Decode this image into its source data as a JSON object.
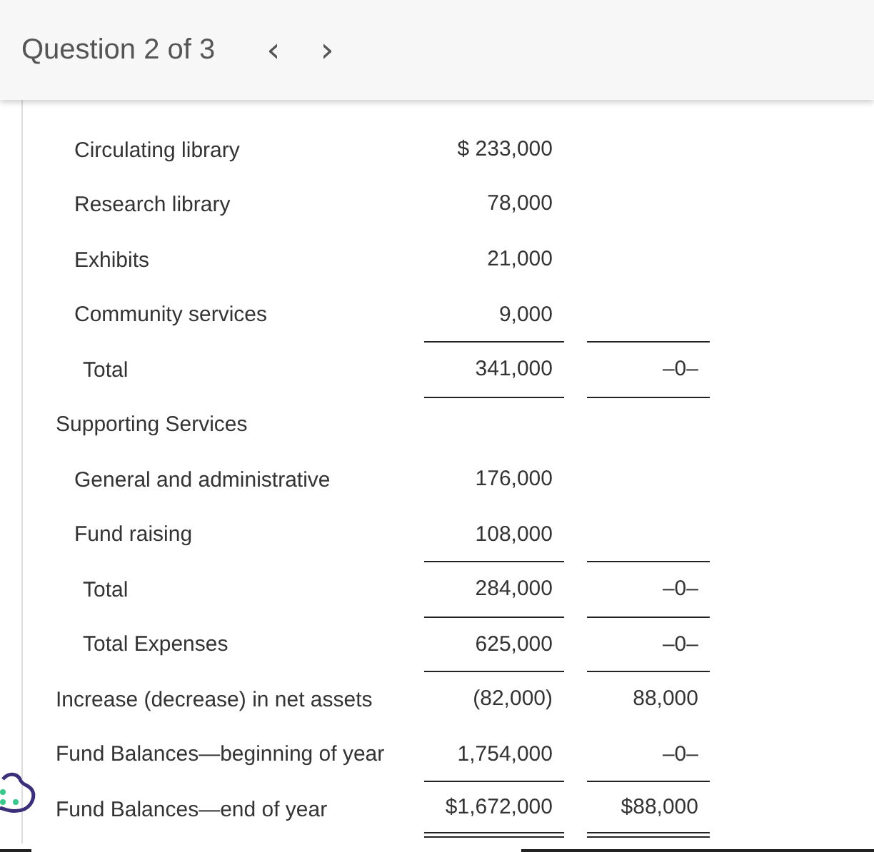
{
  "header": {
    "title": "Question 2 of 3",
    "prev": "‹",
    "next": "›"
  },
  "rows": [
    {
      "kind": "item",
      "label": "Circulating library",
      "c1": "$ 233,000",
      "ruled": false,
      "double_ruled": false
    },
    {
      "kind": "item",
      "label": "Research library",
      "c1": "78,000",
      "ruled": false,
      "double_ruled": false
    },
    {
      "kind": "item",
      "label": "Exhibits",
      "c1": "21,000",
      "ruled": false,
      "double_ruled": false
    },
    {
      "kind": "item",
      "label": "Community services",
      "c1": "9,000",
      "ruled": true,
      "double_ruled": false
    },
    {
      "kind": "total",
      "label": "Total",
      "c1": "341,000",
      "c2": "–0–",
      "ruled": true,
      "double_ruled": false
    },
    {
      "kind": "heading",
      "label": "Supporting Services",
      "ruled": false,
      "double_ruled": false
    },
    {
      "kind": "item",
      "label": "General and administrative",
      "c1": "176,000",
      "ruled": false,
      "double_ruled": false
    },
    {
      "kind": "item",
      "label": "Fund raising",
      "c1": "108,000",
      "ruled": true,
      "double_ruled": false
    },
    {
      "kind": "total",
      "label": "Total",
      "c1": "284,000",
      "c2": "–0–",
      "ruled": true,
      "double_ruled": false
    },
    {
      "kind": "total",
      "label": "Total Expenses",
      "c1": "625,000",
      "c2": "–0–",
      "ruled": true,
      "double_ruled": false
    },
    {
      "kind": "heading",
      "label": "Increase (decrease) in net assets",
      "c1": "(82,000)",
      "c2": "88,000",
      "ruled": false,
      "double_ruled": false
    },
    {
      "kind": "heading",
      "label": "Fund Balances—beginning of year",
      "c1": "1,754,000",
      "c2": "–0–",
      "ruled": true,
      "double_ruled": false
    },
    {
      "kind": "heading",
      "label": "Fund Balances—end of year",
      "c1": "$1,672,000",
      "c2": "$88,000",
      "ruled": false,
      "double_ruled": true
    }
  ]
}
